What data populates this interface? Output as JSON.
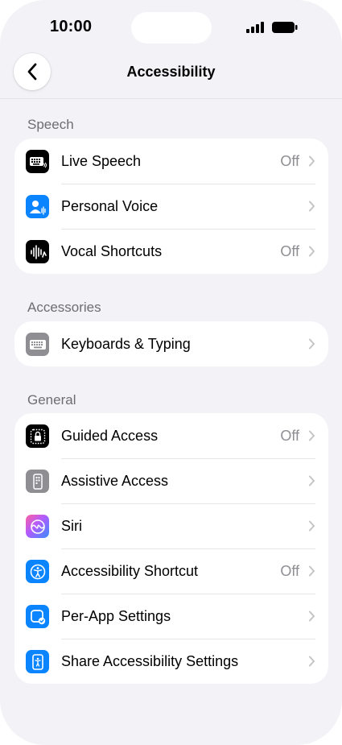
{
  "status_bar": {
    "time": "10:00"
  },
  "nav": {
    "title": "Accessibility"
  },
  "colors": {
    "black_icon": "#000000",
    "blue_icon": "#0a84ff",
    "gray_icon": "#8e8e93",
    "secondary_text": "#8e8e93",
    "background": "#f2f2f7"
  },
  "sections": [
    {
      "header": "Speech",
      "items": [
        {
          "label": "Live Speech",
          "value": "Off",
          "icon": "keyboard-speech-icon"
        },
        {
          "label": "Personal Voice",
          "value": "",
          "icon": "personal-voice-icon"
        },
        {
          "label": "Vocal Shortcuts",
          "value": "Off",
          "icon": "waveform-icon"
        }
      ]
    },
    {
      "header": "Accessories",
      "items": [
        {
          "label": "Keyboards & Typing",
          "value": "",
          "icon": "keyboard-icon"
        }
      ]
    },
    {
      "header": "General",
      "items": [
        {
          "label": "Guided Access",
          "value": "Off",
          "icon": "lock-dotted-icon"
        },
        {
          "label": "Assistive Access",
          "value": "",
          "icon": "assistive-access-icon"
        },
        {
          "label": "Siri",
          "value": "",
          "icon": "siri-icon"
        },
        {
          "label": "Accessibility Shortcut",
          "value": "Off",
          "icon": "accessibility-icon"
        },
        {
          "label": "Per-App Settings",
          "value": "",
          "icon": "per-app-icon"
        },
        {
          "label": "Share Accessibility Settings",
          "value": "",
          "icon": "share-person-icon"
        }
      ]
    }
  ]
}
